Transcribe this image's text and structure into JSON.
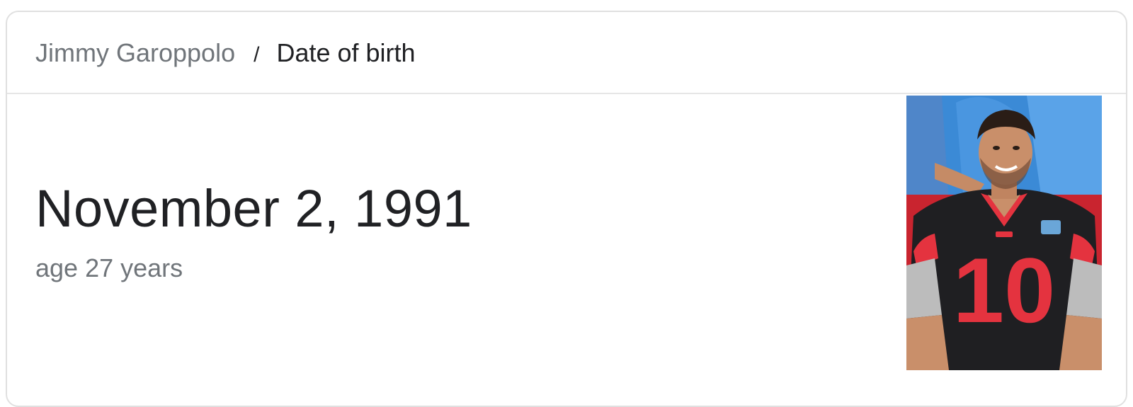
{
  "breadcrumb": {
    "entity": "Jimmy Garoppolo",
    "separator": "/",
    "attribute": "Date of birth"
  },
  "answer": {
    "value": "November 2, 1991",
    "subtitle": "age 27 years"
  },
  "photo": {
    "jersey_number": "10",
    "colors": {
      "jersey": "#1f1f22",
      "jersey_red": "#e4333f",
      "background_shirt": "#3b8ad6",
      "stands_red": "#c9242f",
      "skin": "#c98f6a",
      "hair": "#2a1d16"
    }
  }
}
